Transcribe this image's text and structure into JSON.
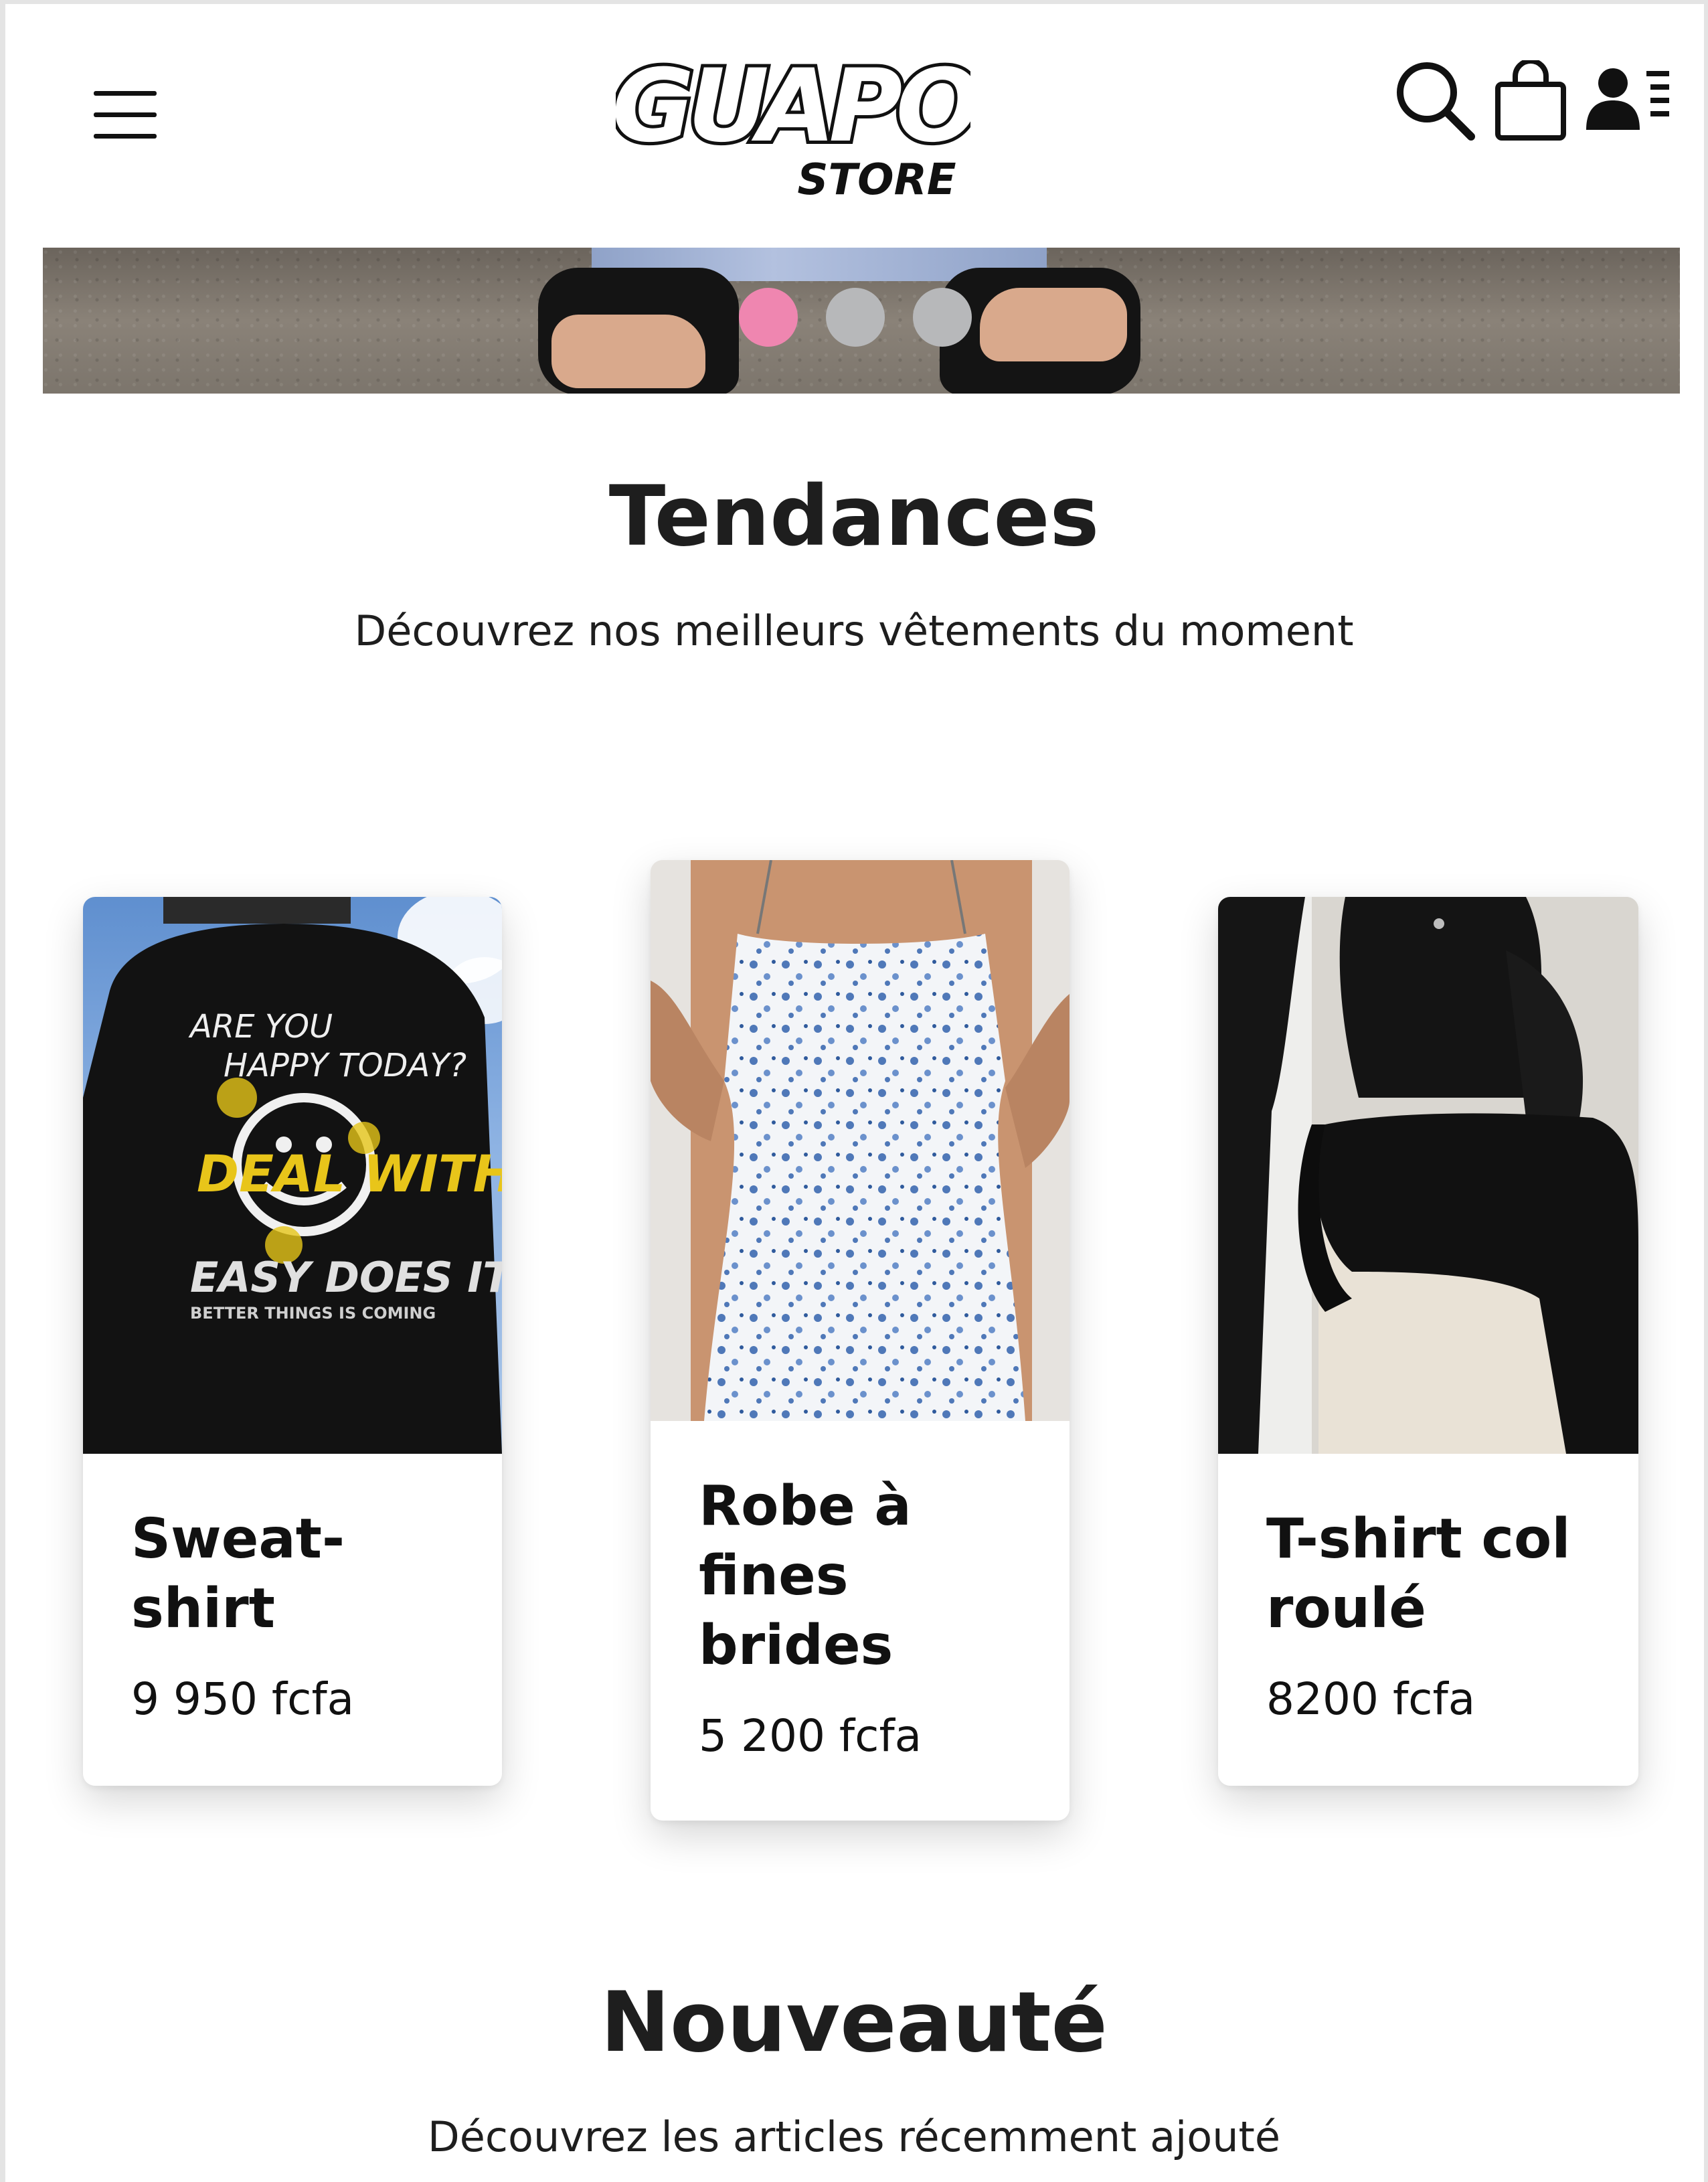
{
  "header": {
    "logo_main": "GUAPO",
    "logo_sub": "STORE",
    "icons": [
      "menu-icon",
      "search-icon",
      "shopping-bag-icon",
      "user-icon"
    ]
  },
  "hero": {
    "slides_total": 3,
    "active_slide": 1
  },
  "trending": {
    "title": "Tendances",
    "subtitle": "Découvrez nos meilleurs vêtements du moment",
    "products": [
      {
        "name": "Sweat-shirt",
        "name_lines": [
          "Sweat-",
          "shirt"
        ],
        "price": "9 950 fcfa",
        "print": [
          "ARE YOU",
          "HAPPY TODAY?",
          "DEAL WITH",
          "EASY DOES IT",
          "BETTER THINGS IS COMING"
        ]
      },
      {
        "name": "Robe à fines brides",
        "name_lines": [
          "Robe à",
          "fines",
          "brides"
        ],
        "price": "5 200 fcfa"
      },
      {
        "name": "T-shirt col roulé",
        "name_lines": [
          "T-shirt col",
          "roulé"
        ],
        "price": "8200 fcfa"
      }
    ]
  },
  "new_arrivals": {
    "title": "Nouveauté",
    "subtitle": "Découvrez les articles récemment ajouté"
  },
  "colors": {
    "active_dot": "#ef86b0",
    "inactive_dot": "#b7b8ba",
    "text": "#1e1e1e"
  }
}
